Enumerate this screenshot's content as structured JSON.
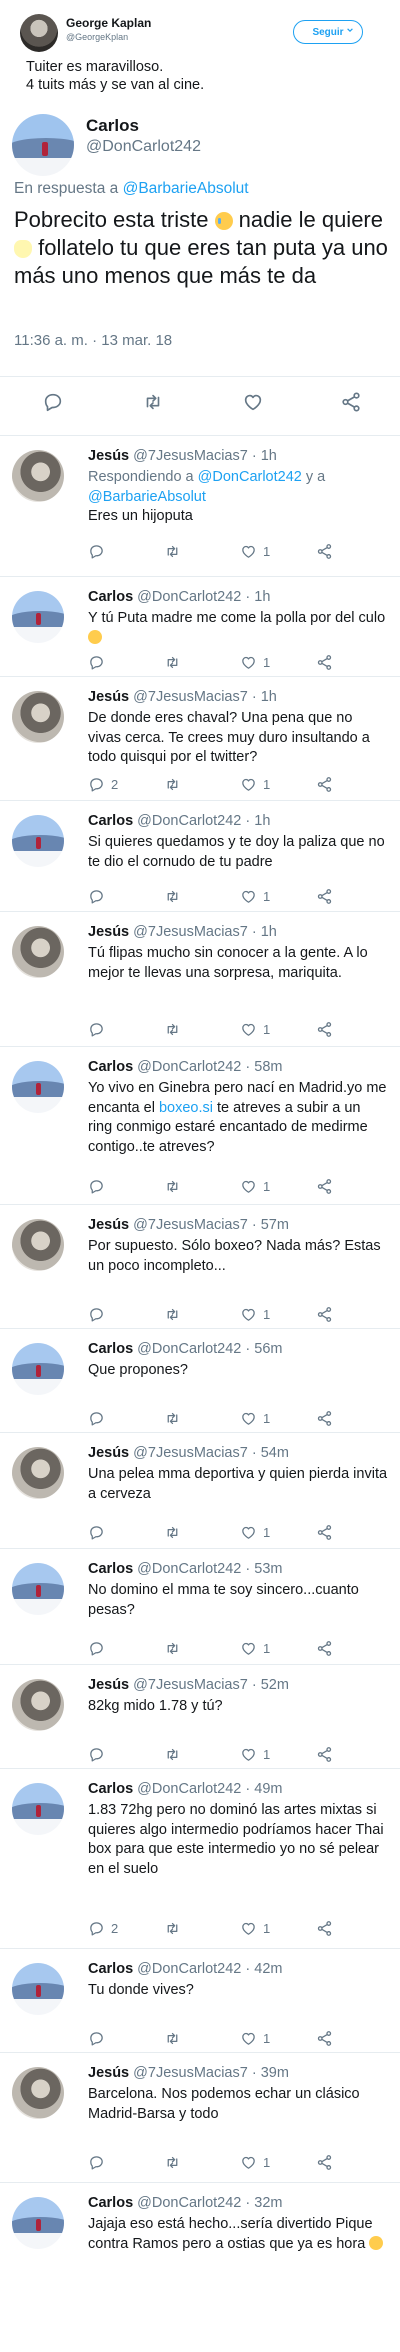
{
  "header": {
    "name": "George Kaplan",
    "handle": "@GeorgeKplan",
    "follow_label": "Seguir",
    "text_line1": "Tuiter es maravilloso.",
    "text_line2": "4 tuits más y se van al cine."
  },
  "main_tweet": {
    "name": "Carlos",
    "handle": "@DonCarlot242",
    "reply_prefix": "En respuesta a ",
    "reply_to": "@BarbarieAbsolut",
    "text_part1": "Pobrecito esta triste ",
    "text_part2": " nadie le quiere ",
    "text_part3": " follatelo tu que eres tan puta ya uno más uno menos que más te da",
    "timestamp": "11:36 a. m. · 13 mar. 18"
  },
  "replies": [
    {
      "name": "Jesús",
      "handle": "@7JesusMacias7",
      "time": "· 1h",
      "replying_prefix": "Respondiendo a ",
      "replying_1": "@DonCarlot242",
      "replying_mid": " y a ",
      "replying_2": "@BarbarieAbsolut",
      "text": "Eres un hijoputa",
      "reply_count": "",
      "like_count": "1"
    },
    {
      "name": "Carlos",
      "handle": "@DonCarlot242",
      "time": "· 1h",
      "text": "Y tú Puta madre me come la polla por del culo ",
      "reply_count": "",
      "like_count": "1"
    },
    {
      "name": "Jesús",
      "handle": "@7JesusMacias7",
      "time": "· 1h",
      "text": "De donde eres chaval? Una pena que no vivas cerca. Te crees muy duro insultando a todo quisqui por el twitter?",
      "reply_count": "2",
      "like_count": "1"
    },
    {
      "name": "Carlos",
      "handle": "@DonCarlot242",
      "time": "· 1h",
      "text": "Si quieres quedamos y te doy la paliza que no te dio el cornudo de tu padre",
      "reply_count": "",
      "like_count": "1"
    },
    {
      "name": "Jesús",
      "handle": "@7JesusMacias7",
      "time": "· 1h",
      "text": "Tú flipas mucho sin conocer a la gente. A lo mejor te llevas una sorpresa, mariquita.",
      "reply_count": "",
      "like_count": "1"
    },
    {
      "name": "Carlos",
      "handle": "@DonCarlot242",
      "time": "· 58m",
      "text_a": "Yo vivo en Ginebra pero nací en Madrid.yo me encanta el ",
      "link": "boxeo.si",
      "text_b": " te atreves a subir a un ring conmigo estaré encantado de medirme contigo..te atreves?",
      "reply_count": "",
      "like_count": "1"
    },
    {
      "name": "Jesús",
      "handle": "@7JesusMacias7",
      "time": "· 57m",
      "text": "Por supuesto. Sólo boxeo? Nada más? Estas un poco incompleto...",
      "reply_count": "",
      "like_count": "1"
    },
    {
      "name": "Carlos",
      "handle": "@DonCarlot242",
      "time": "· 56m",
      "text": "Que propones?",
      "reply_count": "",
      "like_count": "1"
    },
    {
      "name": "Jesús",
      "handle": "@7JesusMacias7",
      "time": "· 54m",
      "text": "Una pelea mma deportiva y quien pierda invita a cerveza",
      "reply_count": "",
      "like_count": "1"
    },
    {
      "name": "Carlos",
      "handle": "@DonCarlot242",
      "time": "· 53m",
      "text": "No domino el mma te soy sincero...cuanto pesas?",
      "reply_count": "",
      "like_count": "1"
    },
    {
      "name": "Jesús",
      "handle": "@7JesusMacias7",
      "time": "· 52m",
      "text": "82kg mido 1.78 y tú?",
      "reply_count": "",
      "like_count": "1"
    },
    {
      "name": "Carlos",
      "handle": "@DonCarlot242",
      "time": "· 49m",
      "text": "1.83 72hg pero no dominó las artes mixtas si quieres algo intermedio podríamos hacer Thai box para que este intermedio yo no sé pelear en el suelo",
      "reply_count": "2",
      "like_count": "1"
    },
    {
      "name": "Carlos",
      "handle": "@DonCarlot242",
      "time": "· 42m",
      "text": "Tu donde vives?",
      "reply_count": "",
      "like_count": "1"
    },
    {
      "name": "Jesús",
      "handle": "@7JesusMacias7",
      "time": "· 39m",
      "text": "Barcelona. Nos podemos echar un clásico Madrid-Barsa y todo",
      "reply_count": "",
      "like_count": "1"
    },
    {
      "name": "Carlos",
      "handle": "@DonCarlot242",
      "time": "· 32m",
      "text": "Jajaja eso está hecho...sería divertido Pique contra Ramos pero a ostias que ya es hora ",
      "reply_count": "",
      "like_count": ""
    }
  ],
  "colors": {
    "accent": "#1da1f2",
    "muted": "#657786",
    "border": "#e6ecf0"
  },
  "icons": [
    "reply-icon",
    "retweet-icon",
    "like-icon",
    "share-icon",
    "chevron-down-icon",
    "emoji-crying-icon",
    "emoji-chick-icon",
    "emoji-blush-icon",
    "emoji-grin-icon"
  ]
}
